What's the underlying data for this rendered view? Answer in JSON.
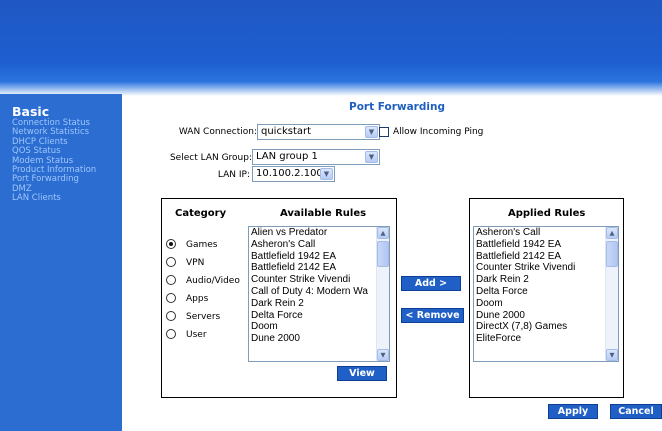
{
  "sidebar": {
    "title": "Basic",
    "items": [
      "Connection Status",
      "Network Statistics",
      "DHCP Clients",
      "QOS Status",
      "Modem Status",
      "Product Information",
      "Port Forwarding",
      "DMZ",
      "LAN Clients"
    ]
  },
  "page": {
    "title": "Port Forwarding"
  },
  "form": {
    "wan_label": "WAN Connection:",
    "wan_value": "quickstart",
    "allow_ping_label": "Allow Incoming Ping",
    "lan_group_label": "Select LAN Group:",
    "lan_group_value": "LAN group 1",
    "lan_ip_label": "LAN IP:",
    "lan_ip_value": "10.100.2.100"
  },
  "category": {
    "header": "Category",
    "selected": "Games",
    "options": [
      "Games",
      "VPN",
      "Audio/Video",
      "Apps",
      "Servers",
      "User"
    ]
  },
  "available": {
    "header": "Available Rules",
    "items": [
      "Alien vs Predator",
      "Asheron's Call",
      "Battlefield 1942 EA",
      "Battlefield 2142 EA",
      "Counter Strike Vivendi",
      "Call of Duty 4: Modern Wa",
      "Dark Rein 2",
      "Delta Force",
      "Doom",
      "Dune 2000"
    ]
  },
  "applied": {
    "header": "Applied Rules",
    "items": [
      "Asheron's Call",
      "Battlefield 1942 EA",
      "Battlefield 2142 EA",
      "Counter Strike Vivendi",
      "Dark Rein 2",
      "Delta Force",
      "Doom",
      "Dune 2000",
      "DirectX (7,8) Games",
      "EliteForce"
    ]
  },
  "buttons": {
    "add": "Add >",
    "remove": "< Remove",
    "view": "View",
    "apply": "Apply",
    "cancel": "Cancel"
  },
  "colors": {
    "accent": "#1f5fc6",
    "sidebar": "#2b6dd0",
    "sidebar_link": "#9fc6ff",
    "title": "#1f5fc0"
  }
}
